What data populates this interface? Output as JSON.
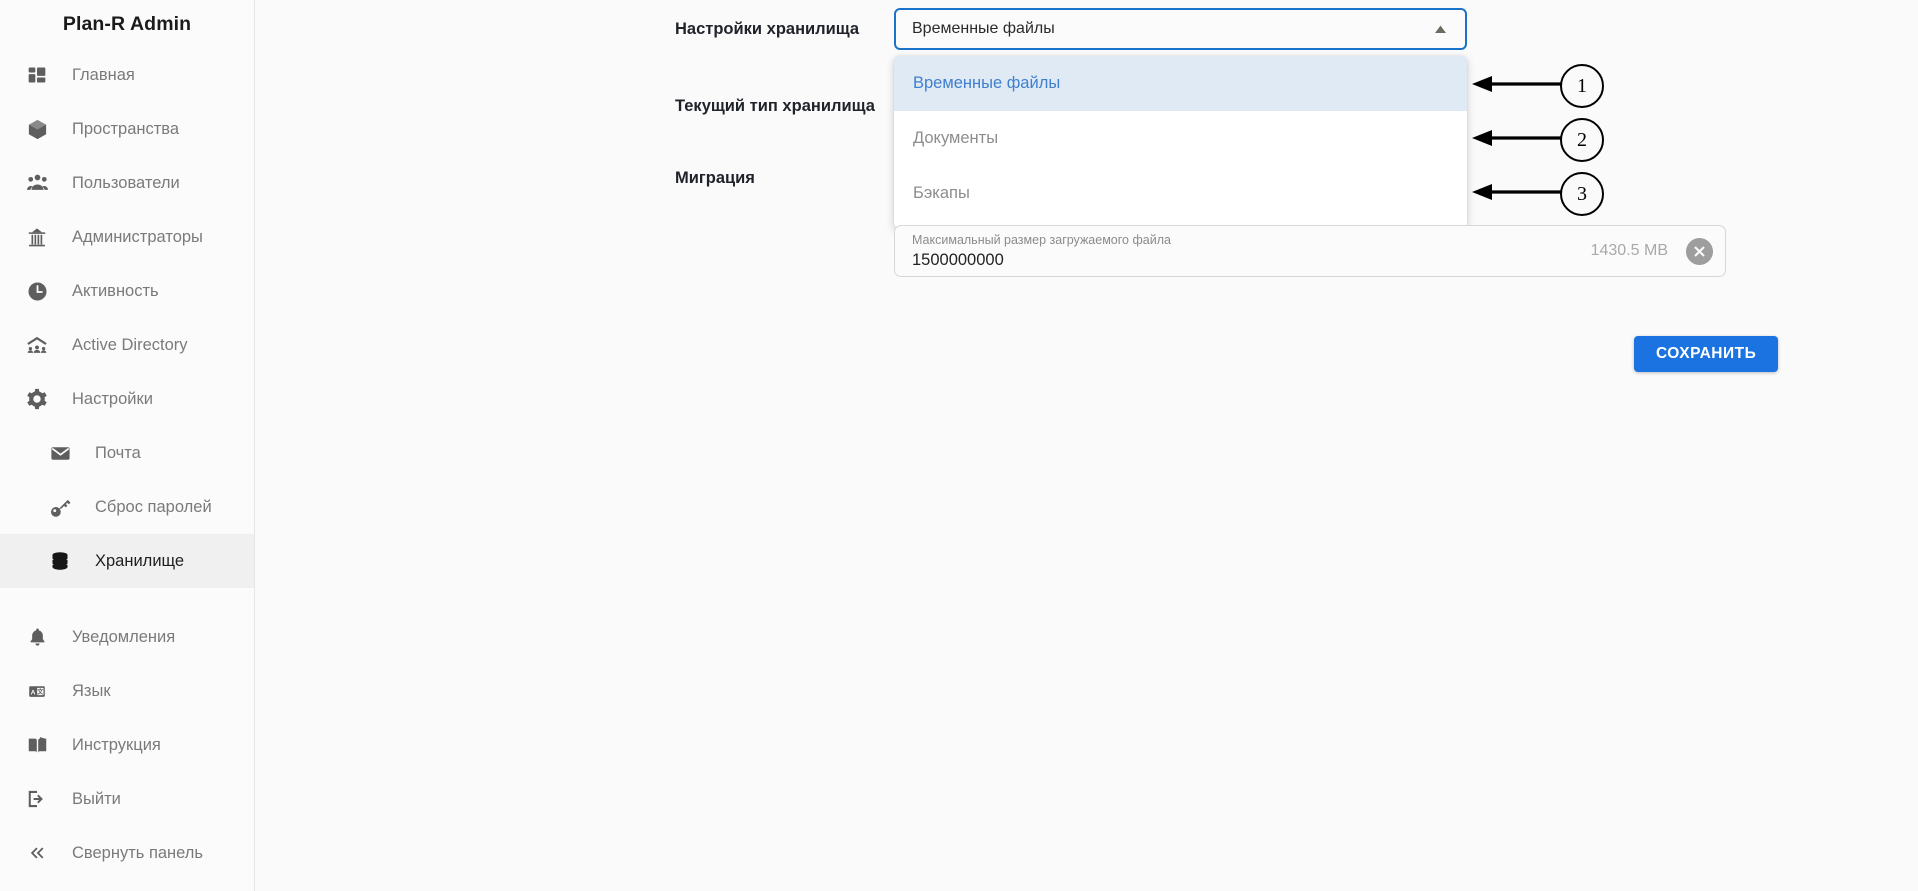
{
  "sidebar": {
    "brand": "Plan-R Admin",
    "items": [
      {
        "label": "Главная",
        "icon": "dashboard-icon",
        "sub": false,
        "active": false
      },
      {
        "label": "Пространства",
        "icon": "box-icon",
        "sub": false,
        "active": false
      },
      {
        "label": "Пользователи",
        "icon": "users-icon",
        "sub": false,
        "active": false
      },
      {
        "label": "Администраторы",
        "icon": "admin-detective-icon",
        "sub": false,
        "active": false
      },
      {
        "label": "Активность",
        "icon": "clock-icon",
        "sub": false,
        "active": false
      },
      {
        "label": "Active Directory",
        "icon": "active-directory-icon",
        "sub": false,
        "active": false
      },
      {
        "label": "Настройки",
        "icon": "gear-icon",
        "sub": false,
        "active": false
      },
      {
        "label": "Почта",
        "icon": "mail-icon",
        "sub": true,
        "active": false
      },
      {
        "label": "Сброс паролей",
        "icon": "key-icon",
        "sub": true,
        "active": false
      },
      {
        "label": "Хранилище",
        "icon": "database-icon",
        "sub": true,
        "active": true
      },
      {
        "label": "Уведомления",
        "icon": "bell-icon",
        "sub": false,
        "active": false
      },
      {
        "label": "Язык",
        "icon": "translate-icon",
        "sub": false,
        "active": false
      },
      {
        "label": "Инструкция",
        "icon": "book-icon",
        "sub": false,
        "active": false
      },
      {
        "label": "Выйти",
        "icon": "logout-icon",
        "sub": false,
        "active": false
      },
      {
        "label": "Свернуть панель",
        "icon": "chevron-double-left-icon",
        "sub": false,
        "active": false
      }
    ]
  },
  "main": {
    "labels": {
      "storage_settings": "Настройки хранилища",
      "current_storage_type": "Текущий тип хранилища",
      "migration": "Миграция"
    },
    "storage_select": {
      "value": "Временные файлы",
      "expanded": true,
      "arrow_icon": "chevron-up-icon",
      "options": [
        {
          "label": "Временные файлы",
          "selected": true
        },
        {
          "label": "Документы",
          "selected": false
        },
        {
          "label": "Бэкапы",
          "selected": false
        }
      ]
    },
    "max_file_size": {
      "caption": "Максимальный размер загружаемого файла",
      "value": "1500000000",
      "suffix": "1430.5 MB",
      "clear_icon": "clear-circle-icon"
    },
    "save_button": "СОХРАНИТЬ"
  },
  "annotations": [
    {
      "number": "1"
    },
    {
      "number": "2"
    },
    {
      "number": "3"
    }
  ],
  "colors": {
    "accent": "#1a73e0",
    "focus_border": "#1a73c8",
    "option_highlight_bg": "#e0eaf4",
    "option_highlight_text": "#3f7fd0",
    "sidebar_bg": "#fbfbfb",
    "sidebar_active_bg": "#f0f0f0",
    "main_bg": "#fafafa"
  }
}
